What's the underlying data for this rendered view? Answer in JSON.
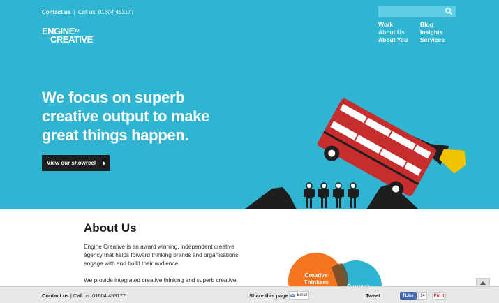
{
  "header": {
    "contact_label": "Contact us",
    "separator": "|",
    "phone": "Call us: 01604 453177",
    "logo_line1": "ENGINE",
    "logo_tm": "TM",
    "logo_line2": "CREATIVE"
  },
  "search": {
    "placeholder": "",
    "value": "",
    "icon": "search-icon"
  },
  "nav": {
    "items": [
      {
        "label": "Work"
      },
      {
        "label": "Blog"
      },
      {
        "label": "About Us"
      },
      {
        "label": "Insights"
      },
      {
        "label": "About You"
      },
      {
        "label": "Services"
      }
    ]
  },
  "hero": {
    "headline": "We focus on superb creative output to make great things happen.",
    "cta_label": "View our showreel"
  },
  "about": {
    "title": "About Us",
    "p1": "Engine Creative is an award winning, independent creative agency that helps forward thinking brands and organisations engage with and build their audience.",
    "p2": "We provide integrated creative thinking and superb creative output for our forward thinking clients."
  },
  "venn": {
    "label_left": "Creative Thinkers",
    "label_right": "Content",
    "color_left": "#f4741f",
    "color_right": "#2fb4d2"
  },
  "footer": {
    "contact_label": "Contact us",
    "separator": "|",
    "phone": "Call us: 01604 453177",
    "share_label": "Share this page",
    "email_label": "Email",
    "tweet_label": "Tweet",
    "like_label": "Like",
    "like_count": "14",
    "pin_label": "Pin it"
  },
  "colors": {
    "hero_bg": "#2fb4d2",
    "button_bg": "#1e1e1e",
    "bus_red": "#c72d2d",
    "flame_yellow": "#f2c300"
  }
}
